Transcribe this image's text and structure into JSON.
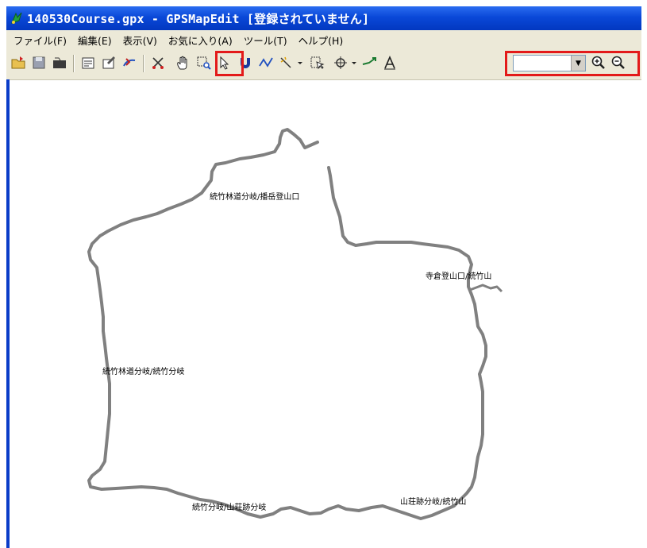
{
  "window": {
    "title": "140530Course.gpx - GPSMapEdit [登録されていません]"
  },
  "menu": [
    {
      "label": "ファイル(F)"
    },
    {
      "label": "編集(E)"
    },
    {
      "label": "表示(V)"
    },
    {
      "label": "お気に入り(A)"
    },
    {
      "label": "ツール(T)"
    },
    {
      "label": "ヘルプ(H)"
    }
  ],
  "toolbar": {
    "tools": [
      "open-icon",
      "save-icon",
      "folder-icon",
      "properties-icon",
      "edit-props-icon",
      "convert-icon",
      "cut-icon",
      "hand-pan-icon",
      "zoom-rect-icon",
      "select-arrow-icon",
      "magnet-icon",
      "polyline-icon",
      "wand-icon",
      "dropdown-icon",
      "select-area-icon",
      "crosshair-icon",
      "dropdown-icon",
      "move-icon",
      "text-icon",
      "zoom-in-icon",
      "zoom-out-icon"
    ],
    "zoom_value": "",
    "highlight_color": "#e31a1a"
  },
  "map": {
    "labels": {
      "top": "続竹林道分岐/播岳登山口",
      "right_upper": "寺倉登山口/続竹山",
      "left": "続竹林道分岐/続竹分岐",
      "bottom_left": "続竹分岐/山荘跡分岐",
      "bottom_right": "山荘跡分岐/続竹山"
    },
    "track_color": "#808080"
  },
  "colors": {
    "title_bar": "#0a48d8",
    "menu_bg": "#ece9d8"
  }
}
